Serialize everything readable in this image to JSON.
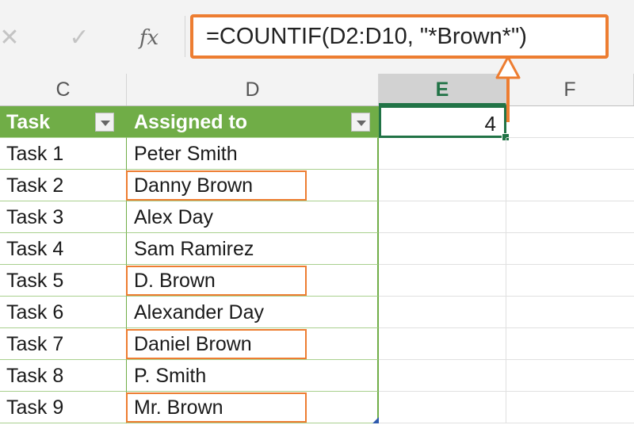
{
  "formula_bar": {
    "cancel_icon": "cancel-icon",
    "enter_icon": "enter-icon",
    "fx_label": "fx",
    "formula": "=COUNTIF(D2:D10, \"*Brown*\")",
    "highlight_color": "#ed7d31"
  },
  "columns": {
    "c": "C",
    "d": "D",
    "e": "E",
    "f": "F",
    "active": "E"
  },
  "table": {
    "header_color": "#70ad47",
    "headers": {
      "task": "Task",
      "assigned": "Assigned to"
    },
    "rows": [
      {
        "task": "Task 1",
        "assigned": "Peter Smith",
        "highlighted": false
      },
      {
        "task": "Task 2",
        "assigned": "Danny Brown",
        "highlighted": true
      },
      {
        "task": "Task 3",
        "assigned": "Alex Day",
        "highlighted": false
      },
      {
        "task": "Task 4",
        "assigned": "Sam Ramirez",
        "highlighted": false
      },
      {
        "task": "Task 5",
        "assigned": "D. Brown",
        "highlighted": true
      },
      {
        "task": "Task 6",
        "assigned": "Alexander Day",
        "highlighted": false
      },
      {
        "task": "Task 7",
        "assigned": "Daniel Brown",
        "highlighted": true
      },
      {
        "task": "Task 8",
        "assigned": "P. Smith",
        "highlighted": false
      },
      {
        "task": "Task 9",
        "assigned": "Mr. Brown",
        "highlighted": true
      }
    ]
  },
  "result": {
    "value": "4",
    "selection_color": "#217346"
  }
}
